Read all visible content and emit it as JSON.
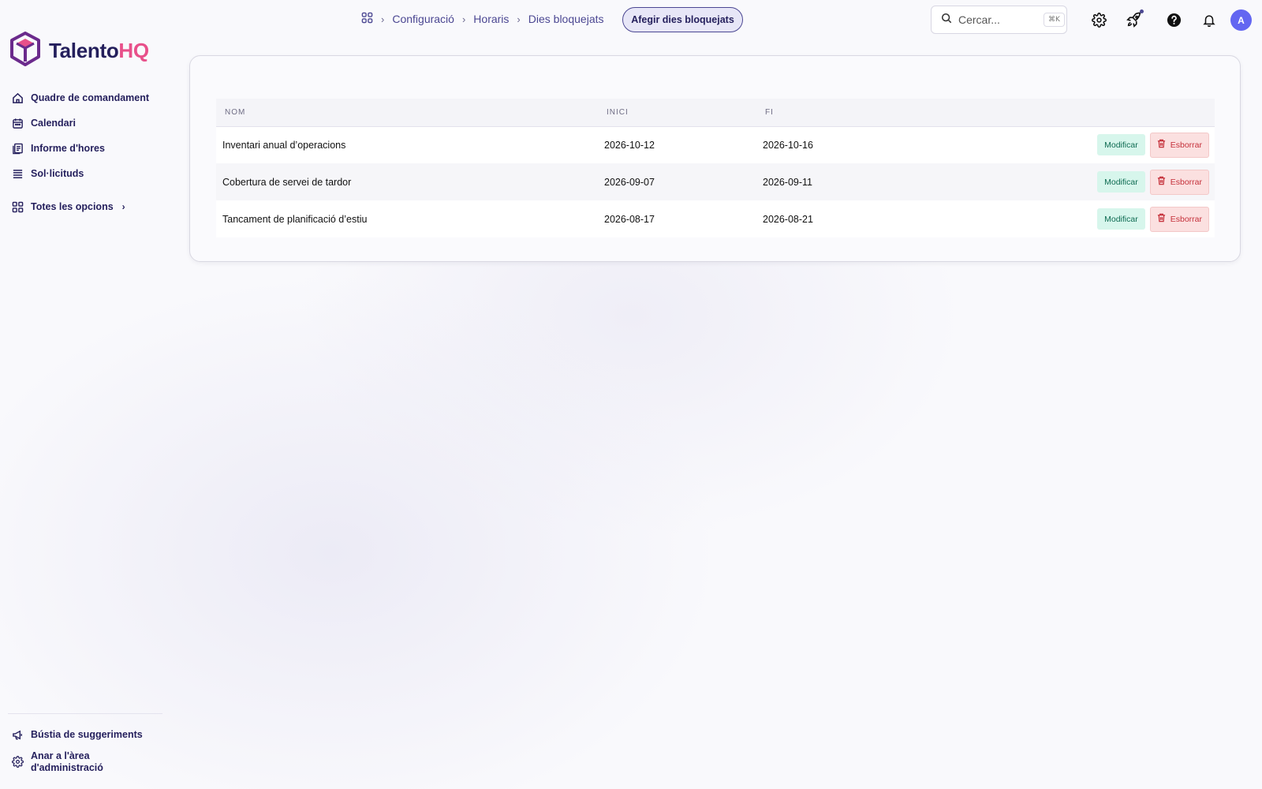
{
  "app": {
    "logo_main": "Talento",
    "logo_accent": "HQ",
    "colors": {
      "brand": "#241f5c",
      "accent": "#e8508a",
      "avatar": "#6366f1"
    }
  },
  "sidebar": {
    "items": [
      {
        "label": "Quadre de comandament",
        "icon": "home-icon"
      },
      {
        "label": "Calendari",
        "icon": "calendar-icon"
      },
      {
        "label": "Informe d'hores",
        "icon": "report-icon"
      },
      {
        "label": "Sol·licituds",
        "icon": "list-icon"
      }
    ],
    "all_options": {
      "label": "Totes les opcions",
      "icon": "grid-icon"
    },
    "bottom": [
      {
        "label": "Bústia de suggeriments",
        "icon": "megaphone-icon"
      },
      {
        "label": "Anar a l'àrea d'administració",
        "icon": "gear-icon"
      }
    ]
  },
  "topbar": {
    "breadcrumb": [
      "Configuració",
      "Horaris",
      "Dies bloquejats"
    ],
    "add_button": "Afegir dies bloquejats",
    "search": {
      "placeholder": "Cercar...",
      "shortcut": "⌘K"
    },
    "avatar_initial": "A"
  },
  "table": {
    "columns": [
      "NOM",
      "INICI",
      "FI"
    ],
    "rows": [
      {
        "name": "Inventari anual d’operacions",
        "start": "2026-10-12",
        "end": "2026-10-16"
      },
      {
        "name": "Cobertura de servei de tardor",
        "start": "2026-09-07",
        "end": "2026-09-11"
      },
      {
        "name": "Tancament de planificació d’estiu",
        "start": "2026-08-17",
        "end": "2026-08-21"
      }
    ],
    "edit_label": "Modificar",
    "delete_label": "Esborrar"
  }
}
